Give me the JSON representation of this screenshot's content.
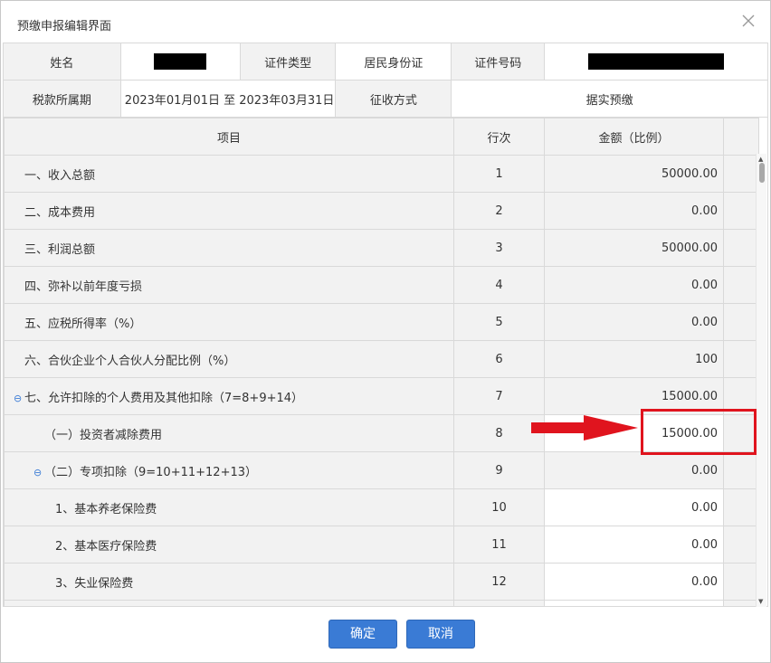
{
  "dialog": {
    "title": "预缴申报编辑界面",
    "close_icon": "close-icon"
  },
  "info": {
    "name_label": "姓名",
    "id_type_label": "证件类型",
    "id_type_value": "居民身份证",
    "id_number_label": "证件号码",
    "period_label": "税款所属期",
    "period_value": "2023年01月01日 至 2023年03月31日",
    "collection_label": "征收方式",
    "collection_value": "据实预缴"
  },
  "table": {
    "headers": [
      "项目",
      "行次",
      "金额（比例）"
    ],
    "rows": [
      {
        "item": "一、收入总额",
        "line": "1",
        "amount": "50000.00"
      },
      {
        "item": "二、成本费用",
        "line": "2",
        "amount": "0.00"
      },
      {
        "item": "三、利润总额",
        "line": "3",
        "amount": "50000.00"
      },
      {
        "item": "四、弥补以前年度亏损",
        "line": "4",
        "amount": "0.00"
      },
      {
        "item": "五、应税所得率（%）",
        "line": "5",
        "amount": "0.00"
      },
      {
        "item": "六、合伙企业个人合伙人分配比例（%）",
        "line": "6",
        "amount": "100"
      },
      {
        "item": "七、允许扣除的个人费用及其他扣除（7=8+9+14）",
        "line": "7",
        "amount": "15000.00"
      },
      {
        "item": "（一）投资者减除费用",
        "line": "8",
        "amount": "15000.00"
      },
      {
        "item": "（二）专项扣除（9=10+11+12+13）",
        "line": "9",
        "amount": "0.00"
      },
      {
        "item": "1、基本养老保险费",
        "line": "10",
        "amount": "0.00"
      },
      {
        "item": "2、基本医疗保险费",
        "line": "11",
        "amount": "0.00"
      },
      {
        "item": "3、失业保险费",
        "line": "12",
        "amount": "0.00"
      }
    ]
  },
  "footer": {
    "ok_label": "确定",
    "cancel_label": "取消"
  },
  "colors": {
    "accent": "#3a7bd5",
    "highlight": "#e0141e"
  }
}
